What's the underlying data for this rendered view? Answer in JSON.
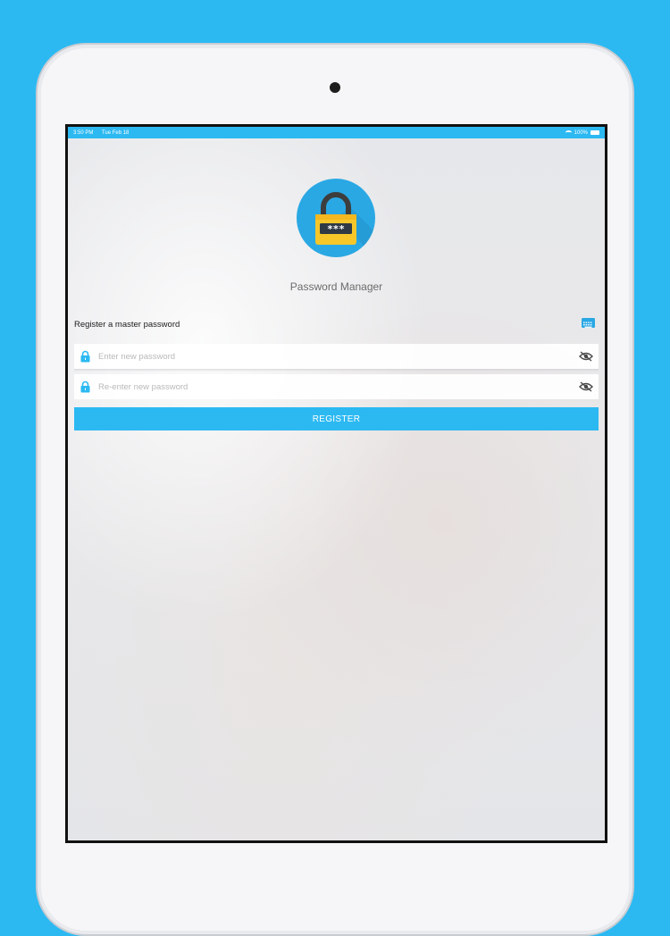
{
  "status_bar": {
    "time": "3:50 PM",
    "date": "Tue Feb 18",
    "battery": "100%"
  },
  "app": {
    "logo_icon": "padlock-icon",
    "title": "Password Manager"
  },
  "form": {
    "section_label": "Register a master password",
    "keyboard_icon": "keyboard-icon",
    "new_password": {
      "value": "",
      "placeholder": "Enter new password"
    },
    "confirm_password": {
      "value": "",
      "placeholder": "Re-enter new password"
    },
    "register_label": "REGISTER"
  },
  "colors": {
    "accent": "#2cb9f2",
    "background": "#2cb9f2",
    "lock_yellow": "#f7c72a"
  }
}
